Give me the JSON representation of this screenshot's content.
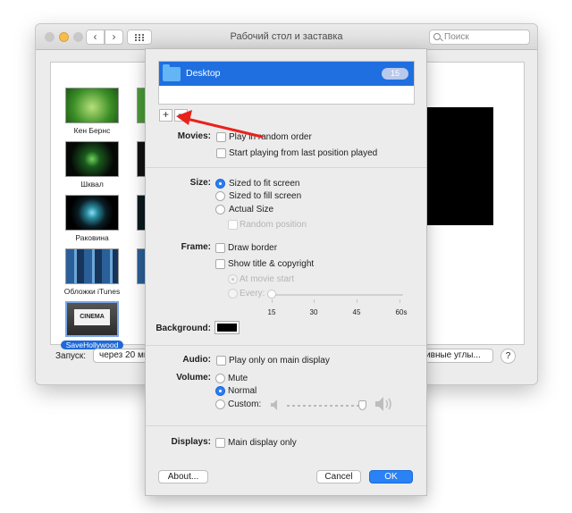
{
  "window": {
    "title": "Рабочий стол и заставка",
    "search_placeholder": "Поиск",
    "nav_back": "‹",
    "nav_forward": "›"
  },
  "savers": [
    {
      "label": "Кен Бернс"
    },
    {
      "label": "Шквал"
    },
    {
      "label": "Раковина"
    },
    {
      "label": "Обложки iTunes"
    },
    {
      "label": "SaveHollywood",
      "selected": true,
      "thumb_text": "CINEMA"
    }
  ],
  "bottom_bar": {
    "start_label": "Запуск:",
    "start_value": "через 20 ми",
    "hot_corners": "ктивные углы...",
    "help": "?"
  },
  "sheet": {
    "list": {
      "items": [
        {
          "label": "Desktop",
          "count": "15"
        }
      ]
    },
    "add": "+",
    "remove": "−",
    "movies": {
      "label": "Movies:",
      "random": "Play in random order",
      "resume": "Start playing from last position played"
    },
    "size": {
      "label": "Size:",
      "options": [
        "Sized to fit screen",
        "Sized to fill screen",
        "Actual Size"
      ],
      "selected": 0,
      "random_position": "Random position"
    },
    "frame": {
      "label": "Frame:",
      "draw_border": "Draw border",
      "show_title": "Show title & copyright",
      "at_start": "At movie start",
      "every": "Every:",
      "ticks": [
        "15",
        "30",
        "45",
        "60s"
      ]
    },
    "background": {
      "label": "Background:",
      "color": "#000000"
    },
    "audio": {
      "label": "Audio:",
      "main_only": "Play only on main display"
    },
    "volume": {
      "label": "Volume:",
      "options": [
        "Mute",
        "Normal",
        "Custom:"
      ],
      "selected": 1
    },
    "displays": {
      "label": "Displays:",
      "main_only": "Main display only"
    },
    "buttons": {
      "about": "About...",
      "cancel": "Cancel",
      "ok": "OK"
    }
  },
  "colors": {
    "accent": "#2a82f4",
    "annotation_arrow": "#e8231b"
  }
}
